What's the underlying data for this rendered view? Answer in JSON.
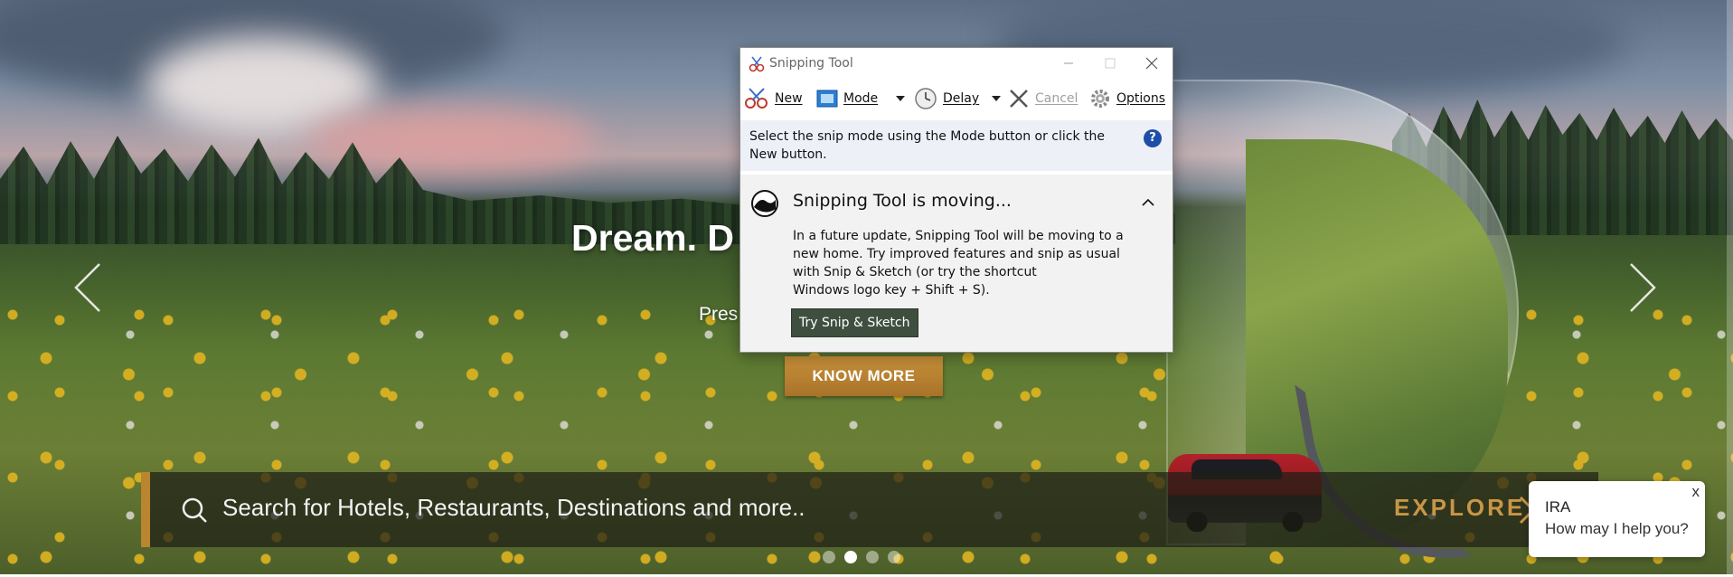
{
  "hero": {
    "title": "Dream. D",
    "subtitle": "Pres",
    "cta_label": "KNOW MORE",
    "prev_icon": "chevron-left-icon",
    "next_icon": "chevron-right-icon",
    "slides_total": 4,
    "active_slide": 2
  },
  "search": {
    "placeholder": "Search for Hotels, Restaurants, Destinations and more..",
    "explore_label": "EXPLORE",
    "icon": "search-icon",
    "accent_color": "#b9852f"
  },
  "chat": {
    "title": "IRA",
    "message": "How may I help you?",
    "close_label": "x"
  },
  "snipping_tool": {
    "window_title": "Snipping Tool",
    "toolbar": {
      "new_label": "New",
      "mode_label": "Mode",
      "delay_label": "Delay",
      "cancel_label": "Cancel",
      "options_label": "Options"
    },
    "instruction": "Select the snip mode using the Mode button or click the New button.",
    "help_label": "?",
    "notice": {
      "heading": "Snipping Tool is moving...",
      "line1": "In a future update, Snipping Tool will be moving to a",
      "line2": "new home. Try improved features and snip as usual",
      "line3": "with Snip & Sketch (or try the shortcut",
      "line4": "Windows logo key + Shift + S).",
      "button_label": "Try Snip & Sketch"
    }
  }
}
